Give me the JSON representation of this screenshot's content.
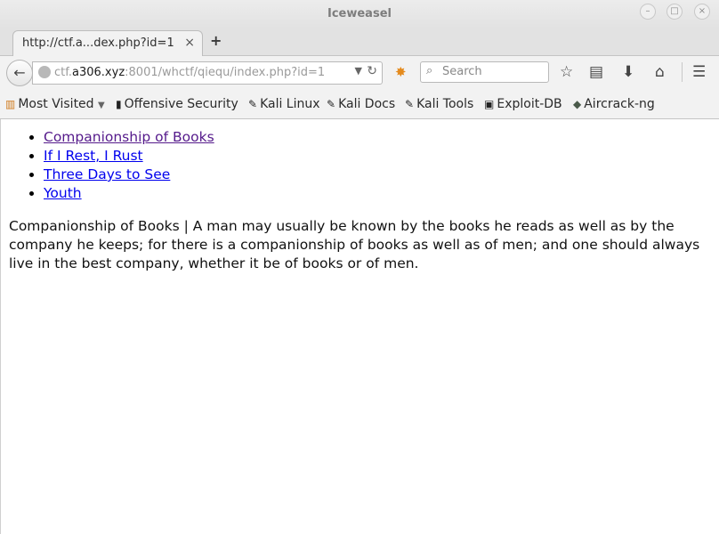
{
  "window": {
    "title": "Iceweasel",
    "buttons": [
      "minimize",
      "maximize",
      "close"
    ]
  },
  "tab": {
    "title": "http://ctf.a...dex.php?id=1",
    "close_glyph": "×",
    "new_tab_glyph": "+"
  },
  "navbar": {
    "url_prefix": "ctf.",
    "url_host": "a306.xyz",
    "url_rest": ":8001/whctf/qiequ/index.php?id=1",
    "search_placeholder": "Search"
  },
  "bookmarks": [
    {
      "label": "Most Visited",
      "icon": "folder-icon"
    },
    {
      "label": "Offensive Security",
      "icon": "offsec-icon"
    },
    {
      "label": "Kali Linux",
      "icon": "kali-icon"
    },
    {
      "label": "Kali Docs",
      "icon": "kali-icon"
    },
    {
      "label": "Kali Tools",
      "icon": "kali-icon"
    },
    {
      "label": "Exploit-DB",
      "icon": "exploitdb-icon"
    },
    {
      "label": "Aircrack-ng",
      "icon": "aircrack-icon"
    }
  ],
  "page": {
    "links": [
      {
        "label": "Companionship of Books",
        "visited": true
      },
      {
        "label": "If I Rest, I Rust",
        "visited": false
      },
      {
        "label": "Three Days to See",
        "visited": false
      },
      {
        "label": "Youth",
        "visited": false
      }
    ],
    "paragraph": "Companionship of Books | A man may usually be known by the books he reads as well as by the company he keeps; for there is a companionship of books as well as of men; and one should always live in the best company, whether it be of books or of men."
  }
}
